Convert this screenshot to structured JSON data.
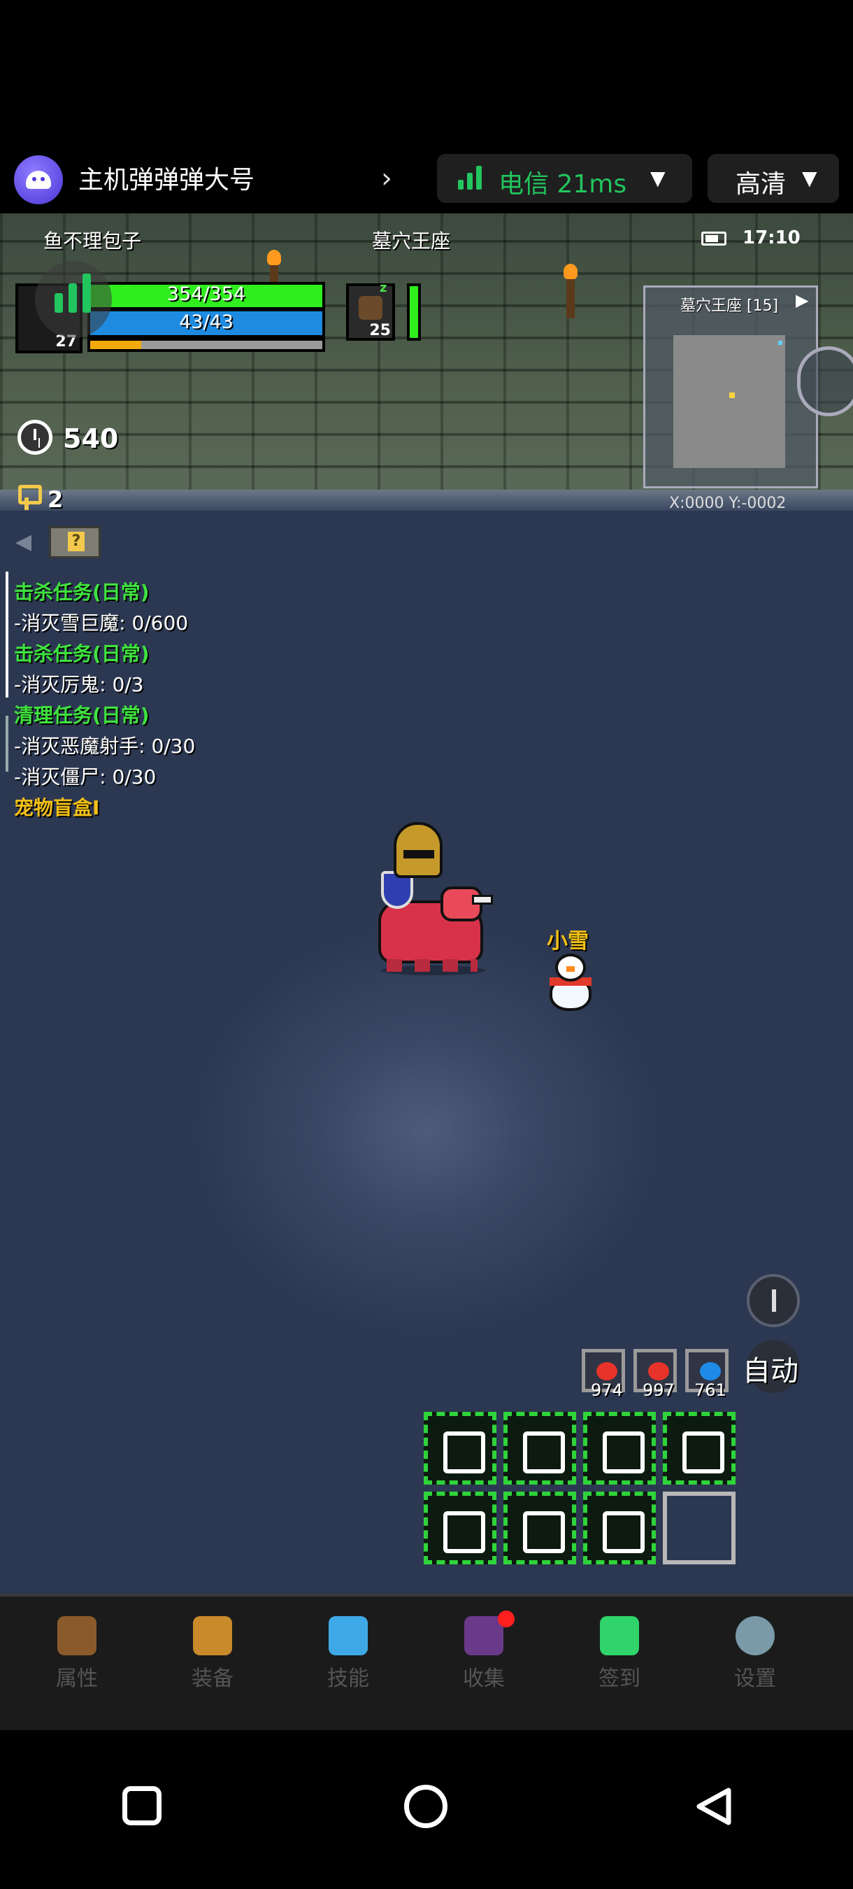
{
  "stream": {
    "app_title": "主机弹弹弹大号",
    "network_label": "电信 21ms",
    "quality_label": "高清",
    "accent_color": "#22c55e"
  },
  "hud": {
    "player_name": "鱼不理包子",
    "map_name": "墓穴王座",
    "time": "17:10",
    "level": "27",
    "hp_text": "354/354",
    "hp_fraction": 1.0,
    "mp_text": "43/43",
    "mp_fraction": 1.0,
    "xp_fraction": 0.22,
    "pet_level": "25",
    "pet_hp_fraction": 1.0,
    "minimap_label": "墓穴王座 [15]",
    "coords": "X:0000 Y:-0002",
    "alarm_value": "540",
    "key_value": "2"
  },
  "quests": [
    {
      "text": "击杀任务(日常)",
      "kind": "header"
    },
    {
      "text": "-消灭雪巨魔: 0/600",
      "kind": "task"
    },
    {
      "text": "击杀任务(日常)",
      "kind": "header"
    },
    {
      "text": "-消灭厉鬼: 0/3",
      "kind": "task"
    },
    {
      "text": "清理任务(日常)",
      "kind": "header"
    },
    {
      "text": "-消灭恶魔射手: 0/30",
      "kind": "task"
    },
    {
      "text": "-消灭僵尸: 0/30",
      "kind": "task"
    },
    {
      "text": "宠物盲盒I",
      "kind": "reward"
    }
  ],
  "pet_name": "小雪",
  "auto_label": "自动",
  "potions": [
    {
      "count": "974",
      "color": "#e8332a"
    },
    {
      "count": "997",
      "color": "#e8332a"
    },
    {
      "count": "761",
      "color": "#1f8be8"
    }
  ],
  "skill_bar": {
    "page_up": "3",
    "page": "1",
    "page_down": "2",
    "skills": [
      "skill-1",
      "skill-2",
      "skill-3",
      "skill-4",
      "skill-5",
      "skill-6",
      "skill-7",
      "empty"
    ]
  },
  "menu": [
    {
      "label": "属性",
      "icon": "helmet-icon"
    },
    {
      "label": "装备",
      "icon": "pot-icon"
    },
    {
      "label": "技能",
      "icon": "gem-skill-icon"
    },
    {
      "label": "收集",
      "icon": "collection-icon",
      "badge": true
    },
    {
      "label": "签到",
      "icon": "checkin-gem-icon"
    },
    {
      "label": "设置",
      "icon": "gear-icon"
    }
  ]
}
